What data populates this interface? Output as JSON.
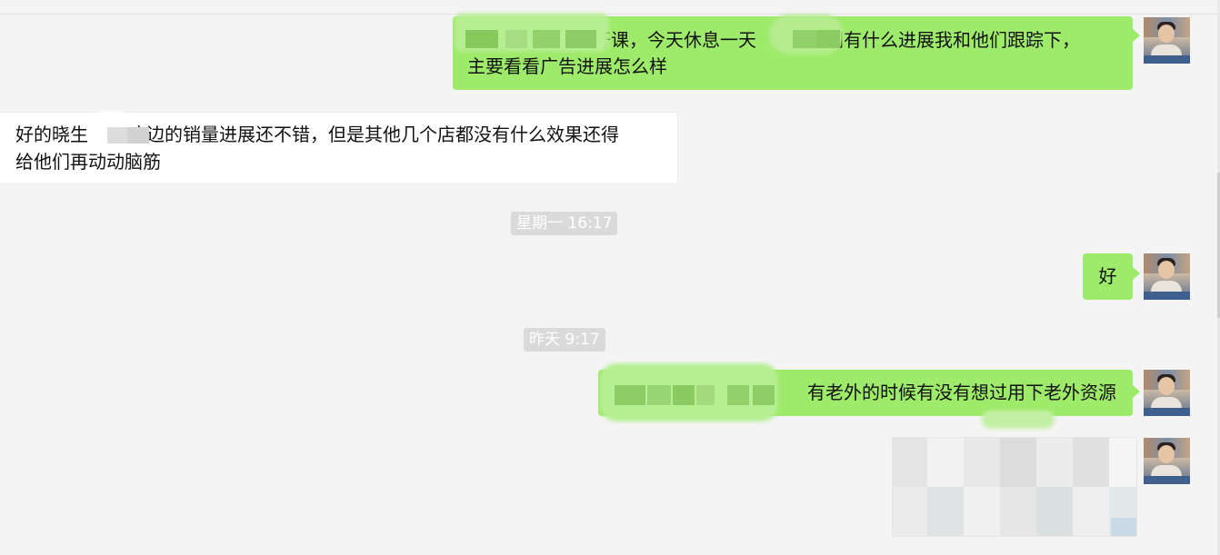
{
  "messages": [
    {
      "sender": "me",
      "text_line1": "开课，今天休息一天",
      "text_line1_end": "们有什么进展我和他们跟踪下，",
      "text_line2": "主要看看广告进展怎么样"
    },
    {
      "sender": "other",
      "text_line1_start": "好的晓生",
      "text_line1_end": "这边的销量进展还不错，但是其他几个店都没有什么效果还得",
      "text_line2": "给他们再动动脑筋"
    },
    {
      "time": "星期一 16:17"
    },
    {
      "sender": "me",
      "text": "好"
    },
    {
      "time": "昨天 9:17"
    },
    {
      "sender": "me",
      "text": "有老外的时候有没有想过用下老外资源"
    },
    {
      "sender": "me",
      "type": "image"
    }
  ],
  "colors": {
    "self_bubble": "#9eea6a",
    "other_bubble": "#ffffff",
    "background": "#f4f4f4",
    "time_tag": "#dadada"
  },
  "icons": [
    "avatar"
  ]
}
